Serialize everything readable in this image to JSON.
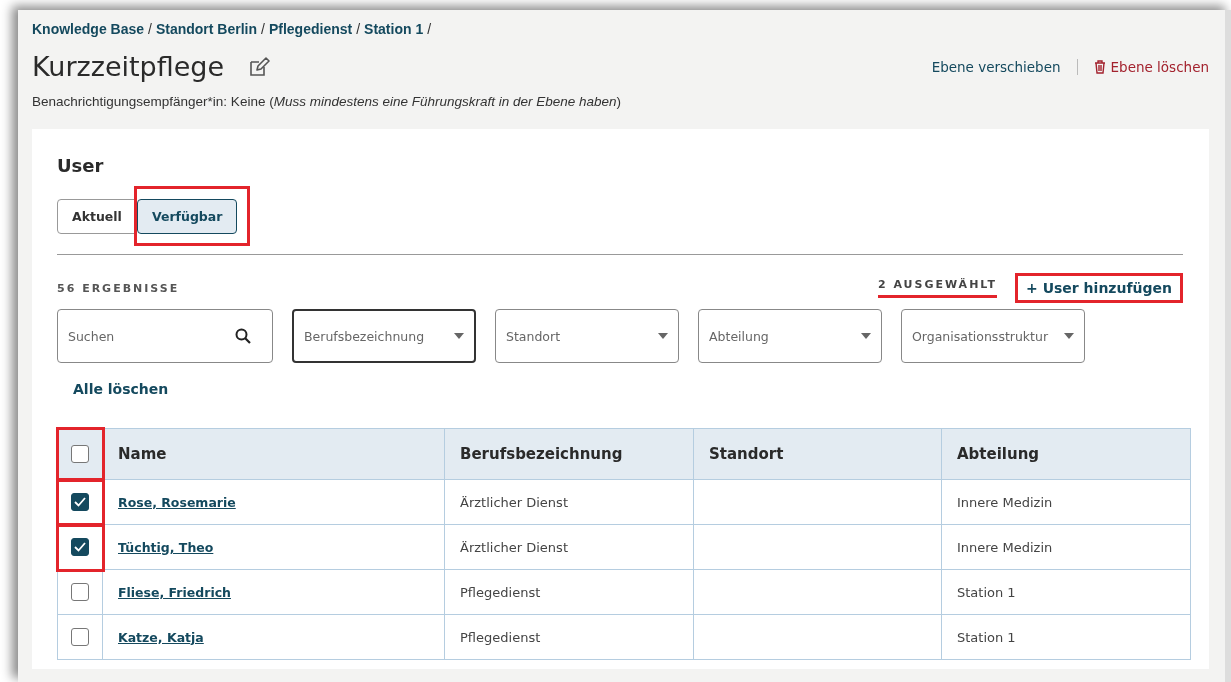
{
  "breadcrumb": {
    "separator": "/",
    "items": [
      {
        "label": "Knowledge Base"
      },
      {
        "label": "Standort Berlin"
      },
      {
        "label": "Pflegedienst"
      },
      {
        "label": "Station 1"
      }
    ]
  },
  "title": "Kurzzeitpflege",
  "actions": [
    {
      "kind": "move",
      "label": "Ebene verschieben"
    },
    {
      "kind": "delete",
      "label": "Ebene löschen"
    }
  ],
  "notice": "Benachrichtigungsempfänger*in: Keine (*Muss mindestens eine Führungskraft in der Ebene haben*)",
  "section": {
    "title": "User",
    "tabs": [
      {
        "label": "Aktuell",
        "selected": false,
        "highlighted": false
      },
      {
        "label": "Verfügbar",
        "selected": true,
        "highlighted": true
      }
    ],
    "results": "56 ERGEBNISSE",
    "selected_count": {
      "text": "2 AUSGEWÄHLT",
      "underlined": true
    },
    "add_button": {
      "label": "+ User hinzufügen",
      "highlighted": true
    },
    "search": {
      "placeholder": "Suchen"
    },
    "filters": [
      {
        "placeholder": "Berufsbezeichnung",
        "focused": true
      },
      {
        "placeholder": "Standort",
        "focused": false
      },
      {
        "placeholder": "Abteilung",
        "focused": false
      },
      {
        "placeholder": "Organisationsstruktur",
        "focused": false
      }
    ],
    "clear_all": "Alle löschen",
    "table": {
      "select_all": {
        "checked": false,
        "highlighted": true
      },
      "columns": [
        "Name",
        "Berufsbezeichnung",
        "Standort",
        "Abteilung"
      ],
      "rows": [
        {
          "checked": true,
          "highlighted": true,
          "name": "Rose, Rosemarie",
          "job": "Ärztlicher Dienst",
          "department": "Innere Medizin"
        },
        {
          "checked": true,
          "highlighted": true,
          "name": "Tüchtig, Theo",
          "job": "Ärztlicher Dienst",
          "department": "Innere Medizin"
        },
        {
          "checked": false,
          "highlighted": false,
          "name": "Fliese, Friedrich",
          "job": "Pflegedienst",
          "department": "Station 1"
        },
        {
          "checked": false,
          "highlighted": false,
          "name": "Katze, Katja",
          "job": "Pflegedienst",
          "department": "Station 1"
        }
      ]
    }
  }
}
